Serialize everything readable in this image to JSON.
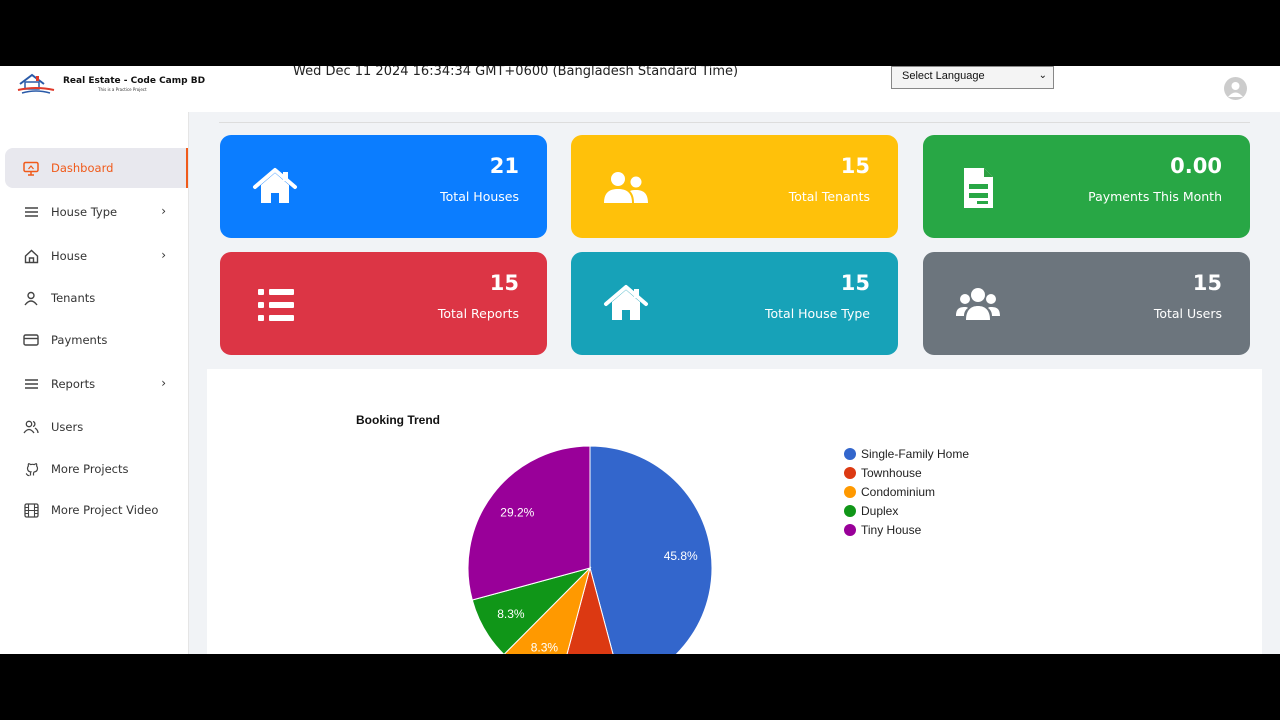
{
  "app": {
    "brand": "Real Estate - Code Camp BD",
    "tagline": "This is a Practice Project",
    "datetime": "Wed Dec 11 2024 16:34:34 GMT+0600 (Bangladesh Standard Time)",
    "language_select": "Select Language"
  },
  "sidebar": {
    "items": [
      {
        "label": "Dashboard",
        "icon": "monitor-icon",
        "active": true
      },
      {
        "label": "House Type",
        "icon": "list-icon",
        "has_submenu": true
      },
      {
        "label": "House",
        "icon": "home-icon",
        "has_submenu": true
      },
      {
        "label": "Tenants",
        "icon": "user-icon"
      },
      {
        "label": "Payments",
        "icon": "credit-card-icon"
      },
      {
        "label": "Reports",
        "icon": "list-icon",
        "has_submenu": true
      },
      {
        "label": "Users",
        "icon": "users-icon"
      },
      {
        "label": "More Projects",
        "icon": "github-icon"
      },
      {
        "label": "More Project Video",
        "icon": "film-icon"
      }
    ]
  },
  "cards": [
    {
      "value": "21",
      "label": "Total Houses",
      "color": "#0b7dff",
      "icon": "house-icon"
    },
    {
      "value": "15",
      "label": "Total Tenants",
      "color": "#ffc10a",
      "icon": "users-icon"
    },
    {
      "value": "0.00",
      "label": "Payments This Month",
      "color": "#28a745",
      "icon": "invoice-icon"
    },
    {
      "value": "15",
      "label": "Total Reports",
      "color": "#dc3545",
      "icon": "list-icon"
    },
    {
      "value": "15",
      "label": "Total House Type",
      "color": "#17a2b8",
      "icon": "house-icon"
    },
    {
      "value": "15",
      "label": "Total Users",
      "color": "#6c757d",
      "icon": "users-group-icon"
    }
  ],
  "chart_data": {
    "type": "pie",
    "title": "Booking Trend",
    "legend_position": "right",
    "slices": [
      {
        "label": "Single-Family Home",
        "value": 45.8,
        "display": "45.8%",
        "color": "#3366cc"
      },
      {
        "label": "Townhouse",
        "value": 8.3,
        "display": "8.3%",
        "color": "#dc3912"
      },
      {
        "label": "Condominium",
        "value": 8.3,
        "display": "8.3%",
        "color": "#ff9900"
      },
      {
        "label": "Duplex",
        "value": 8.3,
        "display": "8.3%",
        "color": "#109618"
      },
      {
        "label": "Tiny House",
        "value": 29.2,
        "display": "29.2%",
        "color": "#990099"
      }
    ]
  }
}
